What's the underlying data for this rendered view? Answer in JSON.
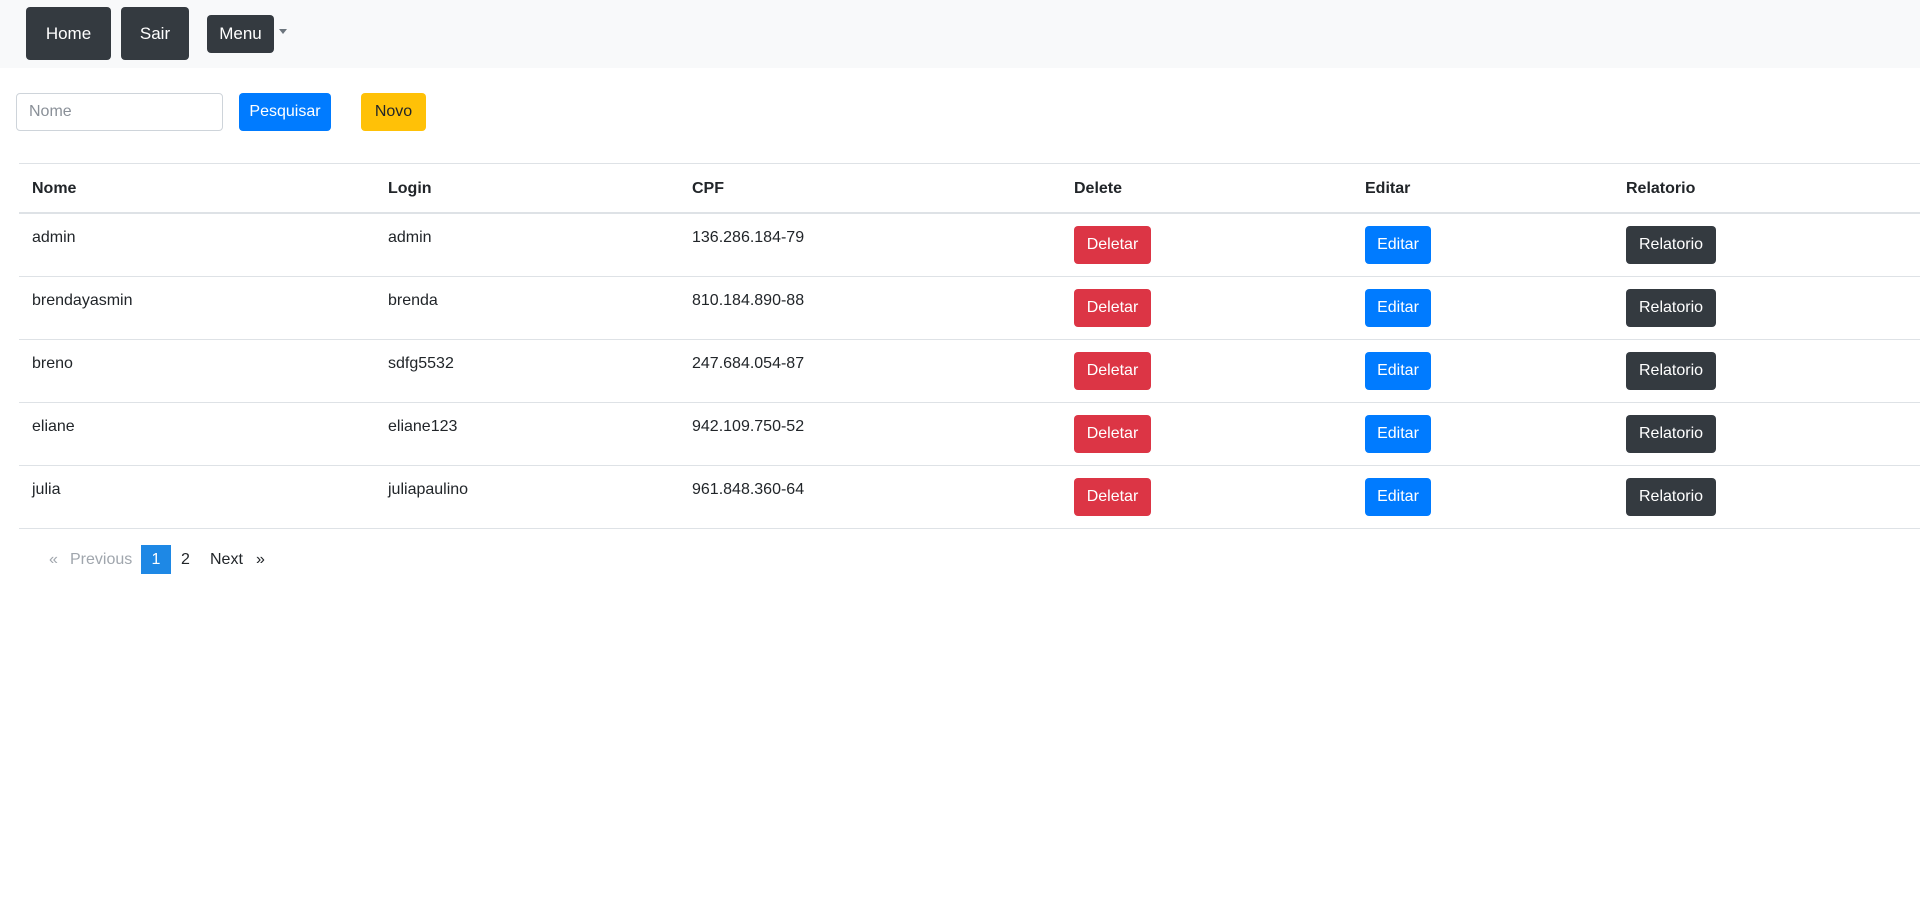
{
  "nav": {
    "home_label": "Home",
    "sair_label": "Sair",
    "menu_label": "Menu"
  },
  "search": {
    "placeholder": "Nome",
    "value": "",
    "search_label": "Pesquisar",
    "new_label": "Novo"
  },
  "table": {
    "headers": {
      "nome": "Nome",
      "login": "Login",
      "cpf": "CPF",
      "delete": "Delete",
      "editar": "Editar",
      "relatorio": "Relatorio"
    },
    "rows": [
      {
        "nome": "admin",
        "login": "admin",
        "cpf": "136.286.184-79",
        "delete_label": "Deletar",
        "edit_label": "Editar",
        "report_label": "Relatorio"
      },
      {
        "nome": "brendayasmin",
        "login": "brenda",
        "cpf": "810.184.890-88",
        "delete_label": "Deletar",
        "edit_label": "Editar",
        "report_label": "Relatorio"
      },
      {
        "nome": "breno",
        "login": "sdfg5532",
        "cpf": "247.684.054-87",
        "delete_label": "Deletar",
        "edit_label": "Editar",
        "report_label": "Relatorio"
      },
      {
        "nome": "eliane",
        "login": "eliane123",
        "cpf": "942.109.750-52",
        "delete_label": "Deletar",
        "edit_label": "Editar",
        "report_label": "Relatorio"
      },
      {
        "nome": "julia",
        "login": "juliapaulino",
        "cpf": "961.848.360-64",
        "delete_label": "Deletar",
        "edit_label": "Editar",
        "report_label": "Relatorio"
      }
    ]
  },
  "pagination": {
    "first_arrow": "«",
    "previous": "Previous",
    "pages": [
      "1",
      "2"
    ],
    "current_page": "1",
    "next": "Next",
    "last_arrow": "»"
  },
  "colors": {
    "primary": "#007bff",
    "danger": "#dc3545",
    "warning": "#ffc107",
    "dark": "#343a40",
    "navbar_bg": "#f8f9fa"
  }
}
